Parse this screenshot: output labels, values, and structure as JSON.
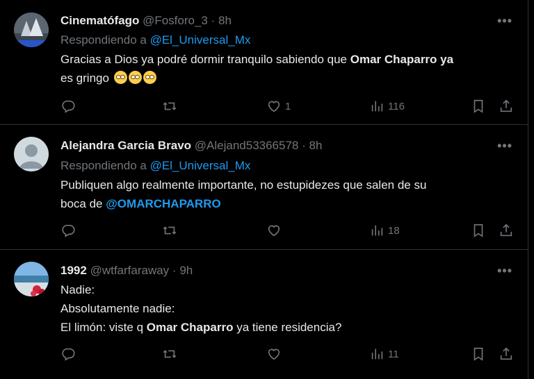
{
  "tweets": [
    {
      "name": "Cinematófago",
      "handle": "@Fosforo_3",
      "time": "8h",
      "replying_prefix": "Respondiendo a",
      "replying_to": "@El_Universal_Mx",
      "text_a": "Gracias a Dios ya podré dormir tranquilo sabiendo que ",
      "bold": "Omar Chaparro ya",
      "text_b": "es gringo ",
      "likes": "1",
      "views": "116"
    },
    {
      "name": "Alejandra Garcia Bravo",
      "handle": "@Alejand53366578",
      "time": "8h",
      "replying_prefix": "Respondiendo a",
      "replying_to": "@El_Universal_Mx",
      "text_a": "Publiquen algo realmente importante, no estupidezes que salen de su",
      "text_b": "boca de ",
      "mention": "@OMARCHAPARRO",
      "views": "18"
    },
    {
      "name": "1992",
      "handle": "@wtfarfaraway",
      "time": "9h",
      "line1": "Nadie:",
      "line2": "Absolutamente nadie:",
      "line3_a": "El limón: viste q ",
      "line3_bold": "Omar Chaparro",
      "line3_b": " ya tiene residencia?",
      "views": "11"
    }
  ],
  "separator": "·",
  "more_icon": "•••"
}
